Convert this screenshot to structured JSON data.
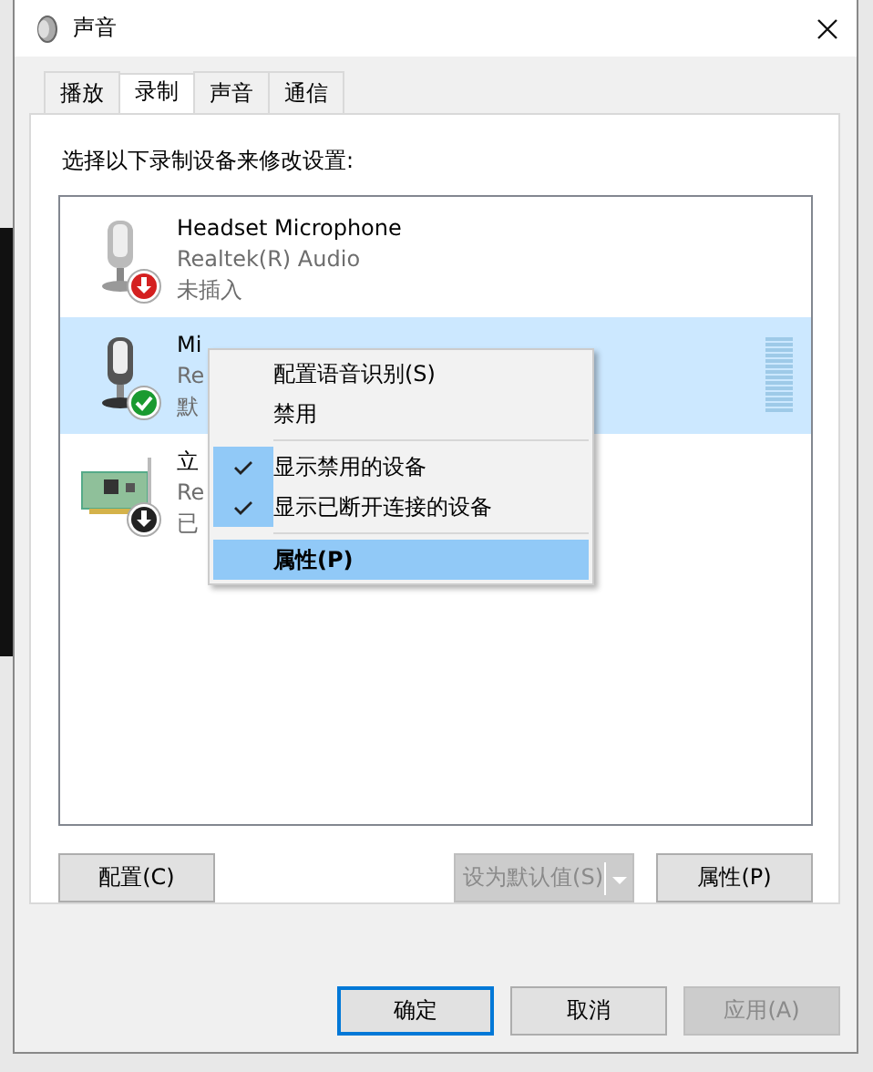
{
  "window": {
    "title": "声音"
  },
  "tabs": [
    {
      "label": "播放",
      "selected": false
    },
    {
      "label": "录制",
      "selected": true
    },
    {
      "label": "声音",
      "selected": false
    },
    {
      "label": "通信",
      "selected": false
    }
  ],
  "instruction": "选择以下录制设备来修改设置:",
  "devices": [
    {
      "name": "Headset Microphone",
      "driver": "Realtek(R) Audio",
      "status_text": "未插入",
      "kind": "microphone",
      "badge": {
        "kind": "unplugged"
      },
      "selected": false
    },
    {
      "name": "Mi",
      "driver": "Re",
      "status_text": "默",
      "kind": "microphone",
      "badge": {
        "kind": "default"
      },
      "selected": true
    },
    {
      "name": "立",
      "driver": "Re",
      "status_text": "已",
      "kind": "card",
      "badge": {
        "kind": "disabled"
      },
      "selected": false
    }
  ],
  "context_menu": {
    "items": [
      {
        "kind": "item",
        "label": "配置语音识别(S)",
        "checked": false,
        "selected": false
      },
      {
        "kind": "item",
        "label": "禁用",
        "checked": false,
        "selected": false
      },
      {
        "kind": "separator"
      },
      {
        "kind": "item",
        "label": "显示禁用的设备",
        "checked": true,
        "selected": false
      },
      {
        "kind": "item",
        "label": "显示已断开连接的设备",
        "checked": true,
        "selected": false
      },
      {
        "kind": "separator"
      },
      {
        "kind": "item",
        "label": "属性(P)",
        "checked": false,
        "selected": true
      }
    ]
  },
  "panel_buttons": {
    "configure": {
      "label": "配置(C)",
      "disabled": false
    },
    "set_default": {
      "label": "设为默认值(S)",
      "disabled": true
    },
    "properties": {
      "label": "属性(P)",
      "disabled": false
    }
  },
  "dialog_buttons": [
    {
      "label": "确定",
      "disabled": false,
      "focused": true
    },
    {
      "label": "取消",
      "disabled": false,
      "focused": false
    },
    {
      "label": "应用(A)",
      "disabled": true,
      "focused": false
    }
  ]
}
